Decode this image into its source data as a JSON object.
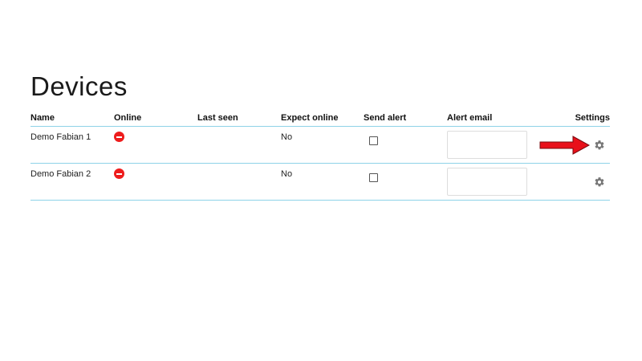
{
  "page": {
    "title": "Devices"
  },
  "table": {
    "headers": {
      "name": "Name",
      "online": "Online",
      "last_seen": "Last seen",
      "expect_online": "Expect online",
      "send_alert": "Send alert",
      "alert_email": "Alert email",
      "settings": "Settings"
    },
    "rows": [
      {
        "name": "Demo Fabian 1",
        "online_status": "offline",
        "last_seen": "",
        "expect_online": "No",
        "send_alert": false,
        "alert_email": "",
        "settings_icon": "gear-icon"
      },
      {
        "name": "Demo Fabian 2",
        "online_status": "offline",
        "last_seen": "",
        "expect_online": "No",
        "send_alert": false,
        "alert_email": "",
        "settings_icon": "gear-icon"
      }
    ]
  },
  "annotation": {
    "arrow_color": "#e8101a",
    "target": "settings of first row"
  },
  "colors": {
    "row_border": "#8ed3e8",
    "offline_status": "#ee1c1c",
    "gear": "#777777"
  }
}
